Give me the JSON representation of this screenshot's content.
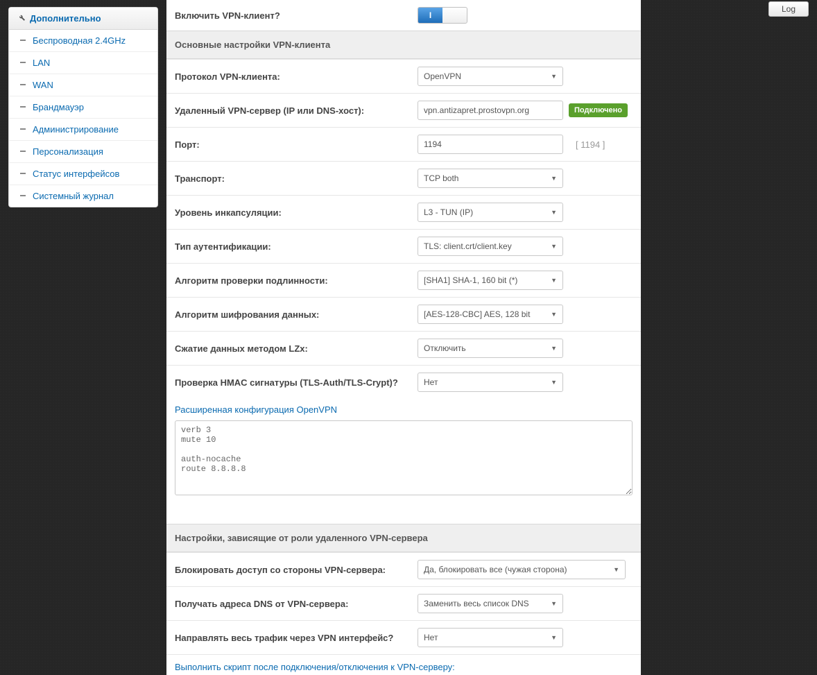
{
  "topbar": {
    "log_button": "Log"
  },
  "sidebar": {
    "header": "Дополнительно",
    "items": [
      "Беспроводная 2.4GHz",
      "LAN",
      "WAN",
      "Брандмауэр",
      "Администрирование",
      "Персонализация",
      "Статус интерфейсов",
      "Системный журнал"
    ]
  },
  "main": {
    "enable_row": {
      "label": "Включить VPN-клиент?",
      "toggle_text": "I"
    },
    "section1_title": "Основные настройки VPN-клиента",
    "rows": {
      "protocol": {
        "label": "Протокол VPN-клиента:",
        "value": "OpenVPN"
      },
      "server": {
        "label": "Удаленный VPN-сервер (IP или DNS-хост):",
        "value": "vpn.antizapret.prostovpn.org",
        "status": "Подключено"
      },
      "port": {
        "label": "Порт:",
        "value": "1194",
        "hint": "[ 1194 ]"
      },
      "transport": {
        "label": "Транспорт:",
        "value": "TCP both"
      },
      "encaps": {
        "label": "Уровень инкапсуляции:",
        "value": "L3 - TUN (IP)"
      },
      "auth_type": {
        "label": "Тип аутентификации:",
        "value": "TLS: client.crt/client.key"
      },
      "auth_alg": {
        "label": "Алгоритм проверки подлинности:",
        "value": "[SHA1] SHA-1, 160 bit (*)"
      },
      "cipher": {
        "label": "Алгоритм шифрования данных:",
        "value": "[AES-128-CBC] AES, 128 bit"
      },
      "compress": {
        "label": "Сжатие данных методом LZx:",
        "value": "Отключить"
      },
      "hmac": {
        "label": "Проверка HMAC сигнатуры (TLS-Auth/TLS-Crypt)?",
        "value": "Нет"
      }
    },
    "advanced_link": "Расширенная конфигурация OpenVPN",
    "advanced_text": "verb 3\nmute 10\n\nauth-nocache\nroute 8.8.8.8",
    "section2_title": "Настройки, зависящие от роли удаленного VPN-сервера",
    "rows2": {
      "block": {
        "label": "Блокировать доступ со стороны VPN-сервера:",
        "value": "Да, блокировать все (чужая сторона)"
      },
      "dns": {
        "label": "Получать адреса DNS от VPN-сервера:",
        "value": "Заменить весь список DNS"
      },
      "route": {
        "label": "Направлять весь трафик через VPN интерфейс?",
        "value": "Нет"
      }
    },
    "script_link": "Выполнить скрипт после подключения/отключения к VPN-серверу:"
  }
}
